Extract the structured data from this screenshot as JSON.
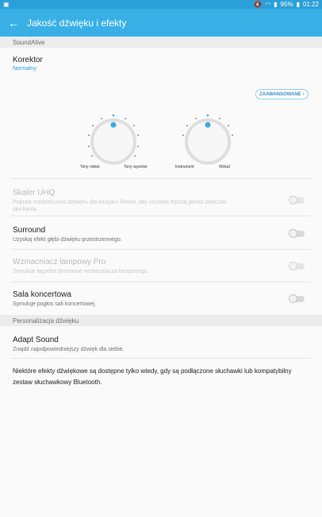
{
  "status": {
    "left_icon": "image-icon",
    "battery": "95%",
    "time": "01:22"
  },
  "appbar": {
    "title": "Jakość dźwięku i efekty"
  },
  "sections": {
    "soundalive": "SoundAlive",
    "personalization": "Personalizacja dźwięku"
  },
  "equalizer": {
    "title": "Korektor",
    "value": "Normalny",
    "advanced_label": "ZAAWANSOWANE",
    "dial1_left": "Tony niskie",
    "dial1_right": "Tony wysokie",
    "dial2_left": "Instrument",
    "dial2_right": "Wokal",
    "accent": "#3aa8e0"
  },
  "items": [
    {
      "title": "Skaler UHQ",
      "desc": "Popraw rozdzielczość dźwięku dla muzyki i filmów, aby uzyskać lepszą jakość podczas słuchania.",
      "enabled": false,
      "on": false
    },
    {
      "title": "Surround",
      "desc": "Uzyskaj efekt głębi dźwięku przestrzennego.",
      "enabled": true,
      "on": false
    },
    {
      "title": "Wzmacniacz lampowy Pro",
      "desc": "Symuluje łagodne brzmienie wzmacniacza lampowego.",
      "enabled": false,
      "on": false
    },
    {
      "title": "Sala koncertowa",
      "desc": "Symuluje pogłos sali koncertowej.",
      "enabled": true,
      "on": false
    }
  ],
  "adapt": {
    "title": "Adapt Sound",
    "desc": "Znajdź najodpowiedniejszy dźwięk dla siebie."
  },
  "note": "Niektóre efekty dźwiękowe są dostępne tylko wtedy, gdy są podłączone słuchawki lub kompatybilny zestaw słuchawkowy Bluetooth."
}
